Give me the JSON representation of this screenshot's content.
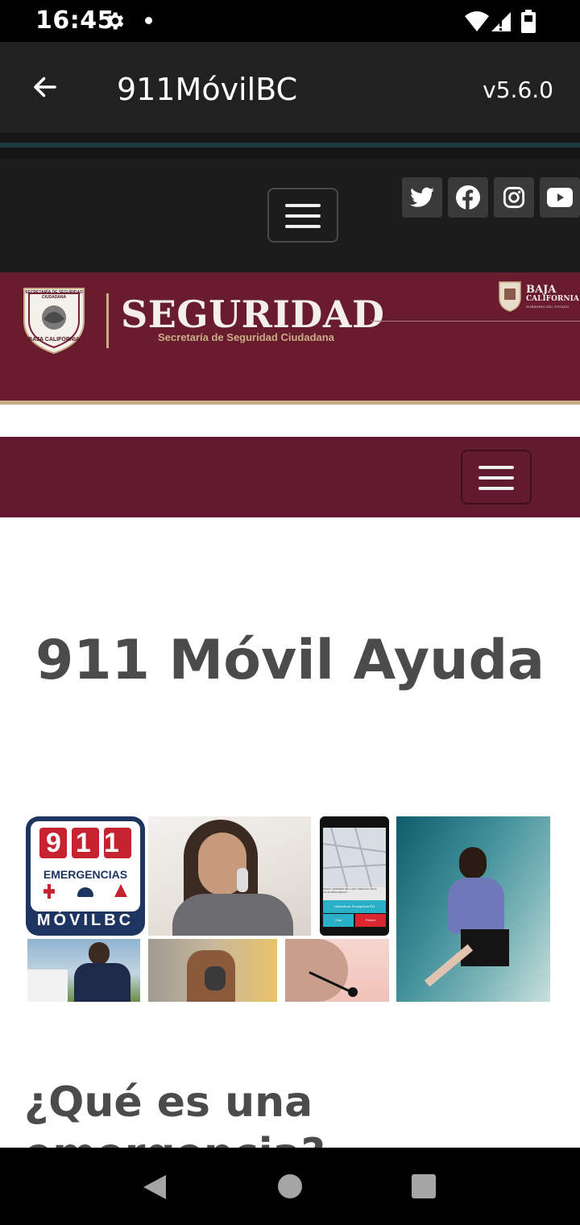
{
  "status_bar": {
    "time": "16:45"
  },
  "app_bar": {
    "title": "911MóvilBC",
    "version": "v5.6.0"
  },
  "social_icons": [
    "twitter-icon",
    "facebook-icon",
    "instagram-icon",
    "youtube-icon"
  ],
  "banner": {
    "seal_top_text": "SECRETARÍA DE SEGURIDAD CIUDADANA",
    "seal_bottom_text": "BAJA CALIFORNIA",
    "title": "SEGURIDAD",
    "subtitle": "Secretaría de Seguridad Ciudadana",
    "state_name_line1": "BAJA",
    "state_name_line2": "CALIFORNIA",
    "state_small": "GOBIERNO DEL ESTADO"
  },
  "main": {
    "heading": "911 Móvil Ayuda",
    "collage_logo": {
      "number": "911",
      "word": "EMERGENCIAS",
      "brand": "MÓVILBC"
    },
    "phone_screen": {
      "address": "FRACC JARDINES DEL LAGO, MEXICALI, BAJA CALIFORNIA MEXICO",
      "call_button": "Llamada de Emergencia 911",
      "chat_button": "Chat",
      "panic_button": "Pánico"
    },
    "section_heading": "¿Qué es una emergencia?"
  },
  "colors": {
    "maroon": "#621a2e",
    "gold": "#c9ad86",
    "app_bar": "#212121"
  }
}
